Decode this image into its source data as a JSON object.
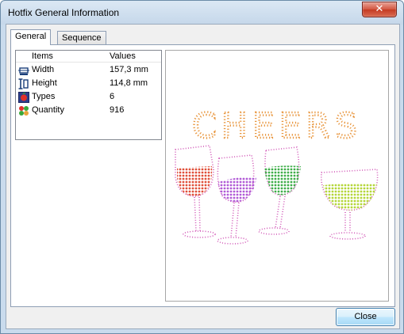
{
  "window": {
    "title": "Hotfix General Information",
    "close_glyph": "✕"
  },
  "tabs": [
    {
      "label": "General",
      "active": true
    },
    {
      "label": "Sequence",
      "active": false
    }
  ],
  "properties": {
    "col_items": "Items",
    "col_values": "Values",
    "rows": [
      {
        "icon": "width-icon",
        "name": "Width",
        "value": "157,3 mm"
      },
      {
        "icon": "height-icon",
        "name": "Height",
        "value": "114,8 mm"
      },
      {
        "icon": "types-icon",
        "name": "Types",
        "value": "6"
      },
      {
        "icon": "quantity-icon",
        "name": "Quantity",
        "value": "916"
      }
    ]
  },
  "preview": {
    "text": "CHEERS",
    "colors": {
      "text": "#e8943a",
      "red": "#e0503a",
      "purple": "#b15bd6",
      "green": "#3fae4a",
      "lime": "#b5d63a",
      "outline": "#d259b8"
    }
  },
  "buttons": {
    "close_label": "Close"
  }
}
